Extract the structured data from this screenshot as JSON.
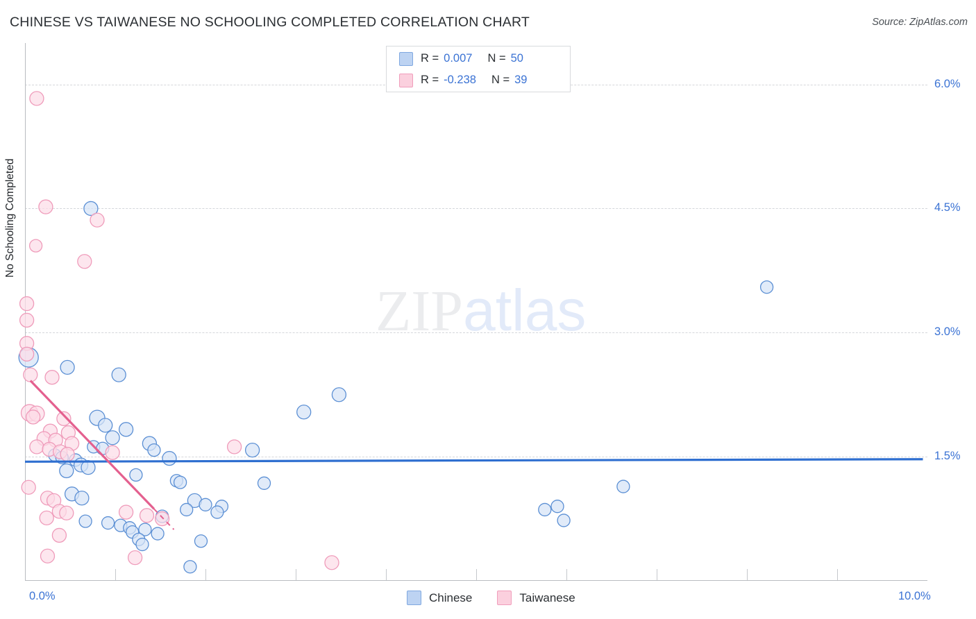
{
  "header": {
    "title": "CHINESE VS TAIWANESE NO SCHOOLING COMPLETED CORRELATION CHART",
    "source": "Source: ZipAtlas.com"
  },
  "watermark": {
    "part1": "ZIP",
    "part2": "atlas"
  },
  "correlation_legend": {
    "rows": [
      {
        "series": "Chinese",
        "r_label": "R =",
        "r_value": "0.007",
        "n_label": "N =",
        "n_value": "50",
        "color": "#bdd3f2"
      },
      {
        "series": "Taiwanese",
        "r_label": "R =",
        "r_value": "-0.238",
        "n_label": "N =",
        "n_value": "39",
        "color": "#fbd0de"
      }
    ]
  },
  "series_legend": {
    "items": [
      {
        "label": "Chinese",
        "fill": "#bdd3f2",
        "stroke": "#7fa8e0"
      },
      {
        "label": "Taiwanese",
        "fill": "#fbd0de",
        "stroke": "#f09dbb"
      }
    ]
  },
  "colors": {
    "blue_marker_fill": "#d5e3f7",
    "blue_marker_stroke": "#5b8fd4",
    "pink_marker_fill": "#fcdde7",
    "pink_marker_stroke": "#ef9bba",
    "blue_trend": "#2f6fd0",
    "pink_trend": "#e4608f",
    "axis": "#b9bcc0",
    "grid": "#d4d6da",
    "tick_text": "#3b73d4",
    "title_text": "#2b2f33"
  },
  "chart_data": {
    "type": "scatter",
    "title": "CHINESE VS TAIWANESE NO SCHOOLING COMPLETED CORRELATION CHART",
    "xlabel": "",
    "ylabel": "No Schooling Completed",
    "xlim": [
      0.0,
      10.0
    ],
    "ylim": [
      0.0,
      6.5
    ],
    "x_unit": "%",
    "y_unit": "%",
    "grid": true,
    "legend_position": "bottom-center",
    "xticks": [
      0.0,
      10.0
    ],
    "xtick_labels": [
      "0.0%",
      "10.0%"
    ],
    "xtick_minor": [
      1.0,
      2.0,
      3.0,
      4.0,
      5.0,
      6.0,
      7.0,
      8.0,
      9.0
    ],
    "yticks": [
      1.5,
      3.0,
      4.5,
      6.0
    ],
    "ytick_labels": [
      "1.5%",
      "3.0%",
      "4.5%",
      "6.0%"
    ],
    "series": [
      {
        "name": "Chinese",
        "color": "#d5e3f7",
        "stroke": "#5b8fd4",
        "r": 0.007,
        "n": 50,
        "trendline": {
          "type": "linear",
          "x0": 0.0,
          "y0": 1.44,
          "x1": 9.95,
          "y1": 1.47,
          "color": "#2f6fd0"
        },
        "points": [
          {
            "x": 0.04,
            "y": 2.7,
            "r": 14
          },
          {
            "x": 0.47,
            "y": 2.58,
            "r": 10
          },
          {
            "x": 0.73,
            "y": 4.5,
            "r": 10
          },
          {
            "x": 1.04,
            "y": 2.49,
            "r": 10
          },
          {
            "x": 3.48,
            "y": 2.25,
            "r": 10
          },
          {
            "x": 3.09,
            "y": 2.04,
            "r": 10
          },
          {
            "x": 8.22,
            "y": 3.55,
            "r": 9
          },
          {
            "x": 0.8,
            "y": 1.97,
            "r": 11
          },
          {
            "x": 0.89,
            "y": 1.88,
            "r": 10
          },
          {
            "x": 1.12,
            "y": 1.83,
            "r": 10
          },
          {
            "x": 0.97,
            "y": 1.73,
            "r": 10
          },
          {
            "x": 0.76,
            "y": 1.62,
            "r": 9
          },
          {
            "x": 0.86,
            "y": 1.6,
            "r": 9
          },
          {
            "x": 1.38,
            "y": 1.66,
            "r": 10
          },
          {
            "x": 1.43,
            "y": 1.58,
            "r": 9
          },
          {
            "x": 2.52,
            "y": 1.58,
            "r": 10
          },
          {
            "x": 0.33,
            "y": 1.52,
            "r": 9
          },
          {
            "x": 0.41,
            "y": 1.49,
            "r": 9
          },
          {
            "x": 0.56,
            "y": 1.46,
            "r": 9
          },
          {
            "x": 0.62,
            "y": 1.4,
            "r": 10
          },
          {
            "x": 0.7,
            "y": 1.37,
            "r": 10
          },
          {
            "x": 1.6,
            "y": 1.48,
            "r": 10
          },
          {
            "x": 0.46,
            "y": 1.33,
            "r": 10
          },
          {
            "x": 1.23,
            "y": 1.28,
            "r": 9
          },
          {
            "x": 1.68,
            "y": 1.21,
            "r": 9
          },
          {
            "x": 1.72,
            "y": 1.19,
            "r": 9
          },
          {
            "x": 2.65,
            "y": 1.18,
            "r": 9
          },
          {
            "x": 6.63,
            "y": 1.14,
            "r": 9
          },
          {
            "x": 0.52,
            "y": 1.05,
            "r": 10
          },
          {
            "x": 0.63,
            "y": 1.0,
            "r": 10
          },
          {
            "x": 1.88,
            "y": 0.97,
            "r": 10
          },
          {
            "x": 2.0,
            "y": 0.92,
            "r": 9
          },
          {
            "x": 2.18,
            "y": 0.9,
            "r": 9
          },
          {
            "x": 1.79,
            "y": 0.86,
            "r": 9
          },
          {
            "x": 2.13,
            "y": 0.83,
            "r": 9
          },
          {
            "x": 5.9,
            "y": 0.9,
            "r": 9
          },
          {
            "x": 5.97,
            "y": 0.73,
            "r": 9
          },
          {
            "x": 0.67,
            "y": 0.72,
            "r": 9
          },
          {
            "x": 0.92,
            "y": 0.7,
            "r": 9
          },
          {
            "x": 1.06,
            "y": 0.67,
            "r": 9
          },
          {
            "x": 1.16,
            "y": 0.64,
            "r": 9
          },
          {
            "x": 1.19,
            "y": 0.59,
            "r": 9
          },
          {
            "x": 1.33,
            "y": 0.62,
            "r": 9
          },
          {
            "x": 1.47,
            "y": 0.57,
            "r": 9
          },
          {
            "x": 1.52,
            "y": 0.78,
            "r": 9
          },
          {
            "x": 1.26,
            "y": 0.5,
            "r": 9
          },
          {
            "x": 1.95,
            "y": 0.48,
            "r": 9
          },
          {
            "x": 1.3,
            "y": 0.44,
            "r": 9
          },
          {
            "x": 1.83,
            "y": 0.17,
            "r": 9
          },
          {
            "x": 5.76,
            "y": 0.86,
            "r": 9
          }
        ]
      },
      {
        "name": "Taiwanese",
        "color": "#fcdde7",
        "stroke": "#ef9bba",
        "r": -0.238,
        "n": 39,
        "trendline": {
          "type": "linear",
          "x0": 0.06,
          "y0": 2.42,
          "x1": 1.65,
          "y1": 0.62,
          "color": "#e4608f",
          "dash_from_x": 1.43
        },
        "points": [
          {
            "x": 0.13,
            "y": 5.83,
            "r": 10
          },
          {
            "x": 0.23,
            "y": 4.52,
            "r": 10
          },
          {
            "x": 0.8,
            "y": 4.36,
            "r": 10
          },
          {
            "x": 0.12,
            "y": 4.05,
            "r": 9
          },
          {
            "x": 0.66,
            "y": 3.86,
            "r": 10
          },
          {
            "x": 0.02,
            "y": 3.35,
            "r": 10
          },
          {
            "x": 0.02,
            "y": 3.15,
            "r": 10
          },
          {
            "x": 0.02,
            "y": 2.87,
            "r": 10
          },
          {
            "x": 0.02,
            "y": 2.74,
            "r": 10
          },
          {
            "x": 0.06,
            "y": 2.49,
            "r": 10
          },
          {
            "x": 0.3,
            "y": 2.46,
            "r": 10
          },
          {
            "x": 0.05,
            "y": 2.03,
            "r": 12
          },
          {
            "x": 0.13,
            "y": 2.02,
            "r": 11
          },
          {
            "x": 0.09,
            "y": 1.98,
            "r": 10
          },
          {
            "x": 0.43,
            "y": 1.96,
            "r": 10
          },
          {
            "x": 0.28,
            "y": 1.81,
            "r": 10
          },
          {
            "x": 0.48,
            "y": 1.79,
            "r": 10
          },
          {
            "x": 0.21,
            "y": 1.72,
            "r": 10
          },
          {
            "x": 0.34,
            "y": 1.7,
            "r": 10
          },
          {
            "x": 0.52,
            "y": 1.66,
            "r": 10
          },
          {
            "x": 0.13,
            "y": 1.62,
            "r": 10
          },
          {
            "x": 0.27,
            "y": 1.59,
            "r": 10
          },
          {
            "x": 0.39,
            "y": 1.56,
            "r": 10
          },
          {
            "x": 0.47,
            "y": 1.53,
            "r": 10
          },
          {
            "x": 0.97,
            "y": 1.55,
            "r": 10
          },
          {
            "x": 2.32,
            "y": 1.62,
            "r": 10
          },
          {
            "x": 0.04,
            "y": 1.13,
            "r": 10
          },
          {
            "x": 0.25,
            "y": 1.0,
            "r": 10
          },
          {
            "x": 0.32,
            "y": 0.97,
            "r": 10
          },
          {
            "x": 0.38,
            "y": 0.84,
            "r": 10
          },
          {
            "x": 0.46,
            "y": 0.82,
            "r": 10
          },
          {
            "x": 0.24,
            "y": 0.76,
            "r": 10
          },
          {
            "x": 1.12,
            "y": 0.83,
            "r": 10
          },
          {
            "x": 1.35,
            "y": 0.79,
            "r": 10
          },
          {
            "x": 1.52,
            "y": 0.75,
            "r": 10
          },
          {
            "x": 0.38,
            "y": 0.55,
            "r": 10
          },
          {
            "x": 0.25,
            "y": 0.3,
            "r": 10
          },
          {
            "x": 1.22,
            "y": 0.28,
            "r": 10
          },
          {
            "x": 3.4,
            "y": 0.22,
            "r": 10
          }
        ]
      }
    ]
  }
}
